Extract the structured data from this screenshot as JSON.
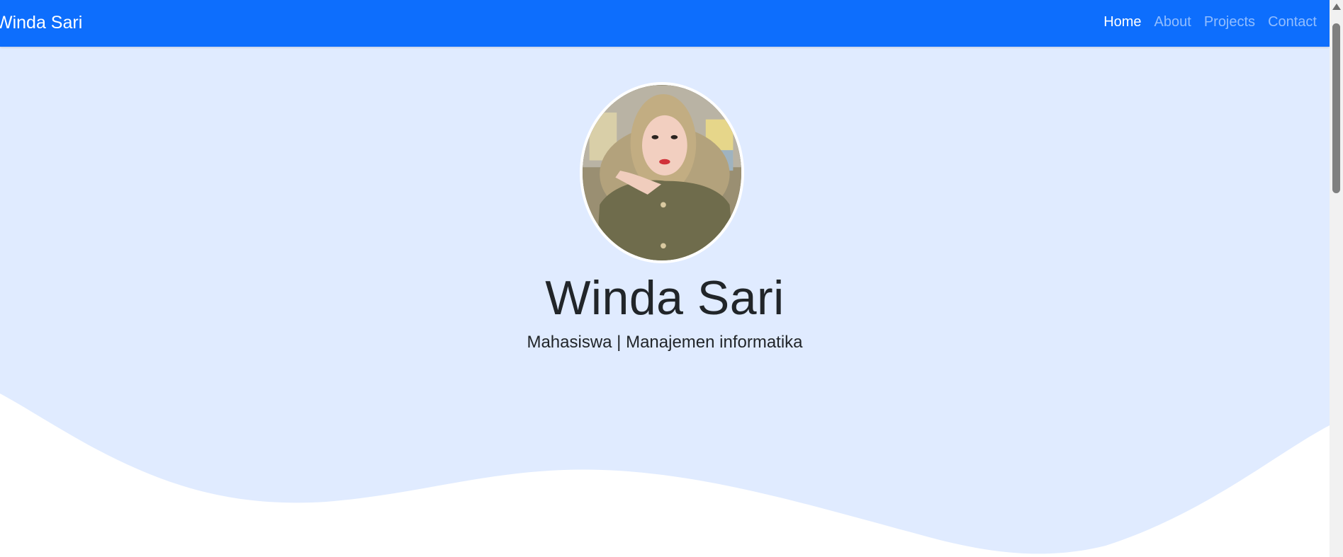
{
  "navbar": {
    "brand": "Winda Sari",
    "links": [
      {
        "label": "Home",
        "active": true
      },
      {
        "label": "About",
        "active": false
      },
      {
        "label": "Projects",
        "active": false
      },
      {
        "label": "Contact",
        "active": false
      }
    ]
  },
  "hero": {
    "title": "Winda Sari",
    "subtitle": "Mahasiswa | Manajemen informatika"
  },
  "colors": {
    "navbar": "#0d6efd",
    "hero_background": "#e0ebff",
    "text": "#212529"
  }
}
